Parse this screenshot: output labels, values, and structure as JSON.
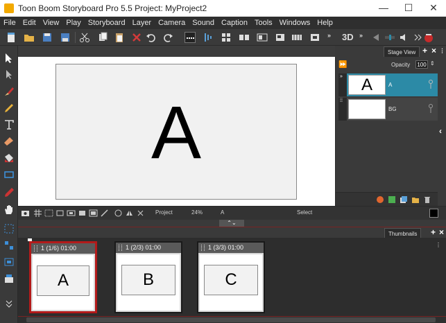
{
  "window": {
    "title": "Toon Boom Storyboard Pro 5.5 Project: MyProject2",
    "minimize": "—",
    "maximize": "☐",
    "close": "✕"
  },
  "menu": [
    "File",
    "Edit",
    "View",
    "Play",
    "Storyboard",
    "Layer",
    "Camera",
    "Sound",
    "Caption",
    "Tools",
    "Windows",
    "Help"
  ],
  "toolbar": {
    "threed_label": "3D"
  },
  "stage": {
    "tab_label": "Stage View",
    "canvas_letter": "A",
    "bottom": {
      "view_mode": "Project",
      "zoom": "24%",
      "layer": "A",
      "tool": "Select"
    }
  },
  "layers": {
    "opacity_label": "Opacity",
    "opacity_value": "100",
    "items": [
      {
        "name": "A",
        "thumb": "A",
        "selected": true
      },
      {
        "name": "BG",
        "thumb": "",
        "selected": false
      }
    ]
  },
  "thumbnails": {
    "tab_label": "Thumbnails",
    "panels": [
      {
        "header": "1 (1/6) 01:00",
        "letter": "A",
        "selected": true
      },
      {
        "header": "1 (2/3) 01:00",
        "letter": "B",
        "selected": false
      },
      {
        "header": "1 (3/3) 01:00",
        "letter": "C",
        "selected": false
      }
    ]
  },
  "colors": {
    "accent": "#2c8aa6",
    "selection": "#b31a1a",
    "background": "#3c3c3c"
  }
}
